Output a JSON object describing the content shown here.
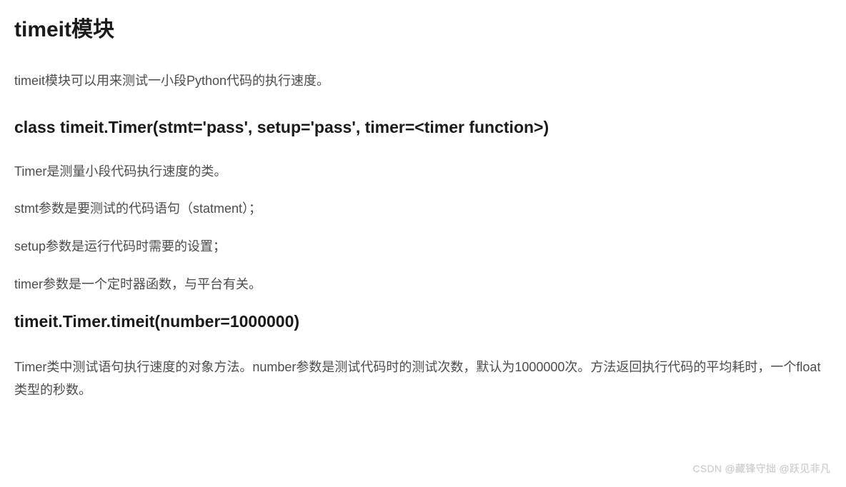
{
  "heading_main": "timeit模块",
  "intro_text": "timeit模块可以用来测试一小段Python代码的执行速度。",
  "class_heading": "class timeit.Timer(stmt='pass', setup='pass', timer=<timer function>)",
  "timer_desc": "Timer是测量小段代码执行速度的类。",
  "stmt_desc": "stmt参数是要测试的代码语句（statment）；",
  "setup_desc": "setup参数是运行代码时需要的设置；",
  "timer_param_desc": "timer参数是一个定时器函数，与平台有关。",
  "method_heading": "timeit.Timer.timeit(number=1000000)",
  "method_desc": "Timer类中测试语句执行速度的对象方法。number参数是测试代码时的测试次数，默认为1000000次。方法返回执行代码的平均耗时，一个float类型的秒数。",
  "watermark": "CSDN @藏锋守拙 @跃见非凡"
}
